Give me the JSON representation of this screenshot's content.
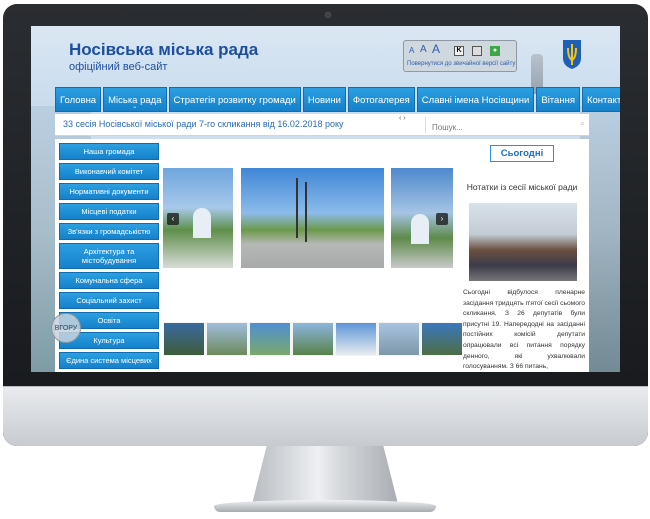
{
  "site": {
    "title": "Носівська міська рада",
    "subtitle": "офіційний веб-сайт"
  },
  "accessibility": {
    "font_small": "A",
    "font_mid": "A",
    "font_large": "A",
    "contrast_label": "K",
    "back_link": "Повернутися до звичайної версії сайту"
  },
  "nav": {
    "items": [
      {
        "label": "Головна"
      },
      {
        "label": "Міська рада",
        "chevron": "⌄"
      },
      {
        "label": "Стратегія розвитку громади"
      },
      {
        "label": "Новини"
      },
      {
        "label": "Фотогалерея"
      },
      {
        "label": "Славні імена Носівщини"
      },
      {
        "label": "Вітання"
      },
      {
        "label": "Контакти"
      }
    ]
  },
  "ticker": {
    "text": "33 сесія Носівської міської ради 7-го скликання від 16.02.2018 року",
    "arrows": "‹ ›"
  },
  "search": {
    "placeholder": "Пошук...",
    "icon": "search-icon"
  },
  "sidebar": {
    "items": [
      {
        "label": "Наша громада"
      },
      {
        "label": "Виконавчий комітет"
      },
      {
        "label": "Нормативні документи"
      },
      {
        "label": "Місцеві податки"
      },
      {
        "label": "Зв'язки з громадськістю"
      },
      {
        "label": "Архітектура та містобудування"
      },
      {
        "label": "Комунальна сфера"
      },
      {
        "label": "Соціальний захист"
      },
      {
        "label": "Освіта"
      },
      {
        "label": "Культура"
      },
      {
        "label": "Єдина система місцевих"
      }
    ],
    "up_button": "ВГОРУ"
  },
  "gallery": {
    "prev": "‹",
    "next": "›"
  },
  "right": {
    "today_label": "Сьогодні",
    "news_title": "Нотатки із сесії міської ради",
    "news_text": "Сьогодні відбулося пленарне засідання тридцять п'ятої сесії сьомого скликання. З 26 депутатів були присутні 19. Напередодні на засіданні постійних комісій депутати опрацювали всі питання порядку денного, які ухвалювали голосуванням. З 66 питань,"
  },
  "colors": {
    "accent": "#1581cb",
    "title": "#1d4f9c",
    "ticker": "#2a6bb8"
  }
}
